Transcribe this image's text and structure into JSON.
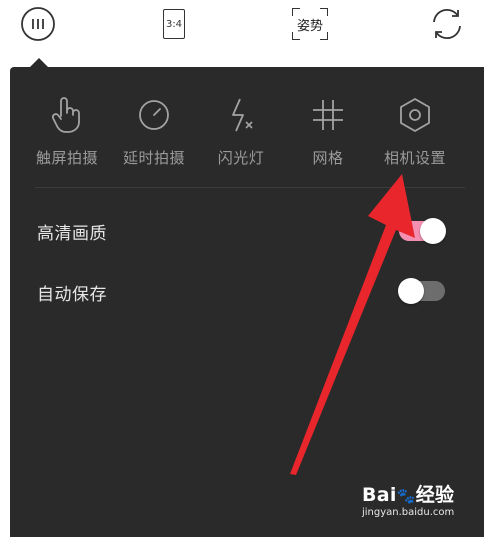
{
  "top_toolbar": {
    "ratio_label": "3:4",
    "pose_label": "姿势",
    "icons": [
      "menu-circle-icon",
      "aspect-ratio-icon",
      "pose-icon",
      "switch-camera-icon"
    ]
  },
  "tools": [
    {
      "label": "触屏拍摄",
      "icon": "touch-hand-icon"
    },
    {
      "label": "延时拍摄",
      "icon": "timer-icon"
    },
    {
      "label": "闪光灯",
      "icon": "flash-off-icon"
    },
    {
      "label": "网格",
      "icon": "grid-icon"
    },
    {
      "label": "相机设置",
      "icon": "hexagon-settings-icon"
    }
  ],
  "settings": {
    "hd_quality": {
      "label": "高清画质",
      "enabled": true
    },
    "auto_save": {
      "label": "自动保存",
      "enabled": false
    }
  },
  "colors": {
    "panel_bg": "#2a2a2a",
    "toggle_on": "#f48fb1",
    "toggle_off": "#6d6d6d",
    "arrow": "#e8262b",
    "label": "#9a9a9a"
  },
  "watermark": {
    "brand_prefix": "Bai",
    "brand_suffix": "经验",
    "url": "jingyan.baidu.com"
  }
}
